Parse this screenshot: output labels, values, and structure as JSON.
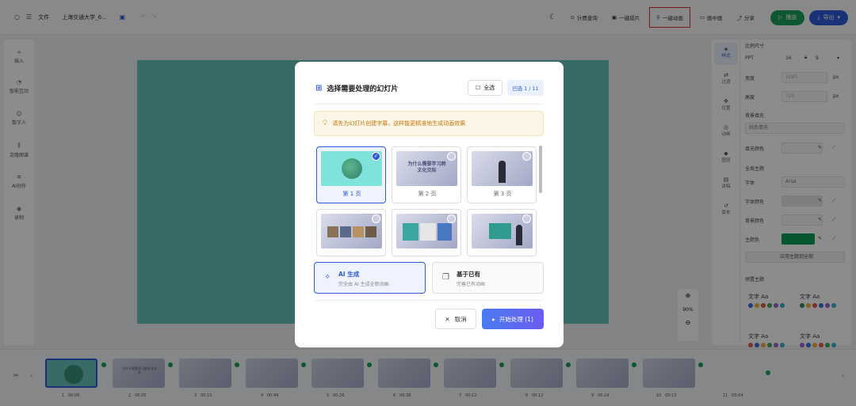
{
  "topbar": {
    "file_menu": "文件",
    "doc_title": "上海交通大学_6...",
    "buttons": [
      {
        "label": "计费查询",
        "icon": "billing-icon"
      },
      {
        "label": "一键成片",
        "icon": "film-icon"
      },
      {
        "label": "一键动画",
        "icon": "animation-icon"
      },
      {
        "label": "画中画",
        "icon": "pip-icon"
      },
      {
        "label": "分享",
        "icon": "share-icon"
      }
    ],
    "play_label": "播放",
    "export_label": "导出"
  },
  "leftbar": {
    "items": [
      {
        "label": "插入",
        "icon": "plus-icon"
      },
      {
        "label": "智能互动",
        "icon": "interact-icon"
      },
      {
        "label": "数字人",
        "icon": "avatar-icon"
      },
      {
        "label": "克隆图谱",
        "icon": "graph-icon"
      },
      {
        "label": "AI创作",
        "icon": "ai-icon"
      },
      {
        "label": "录制",
        "icon": "record-icon"
      }
    ]
  },
  "rightbar": {
    "tabs": [
      {
        "label": "样式",
        "icon": "style-icon",
        "active": true
      },
      {
        "label": "过渡",
        "icon": "transition-icon",
        "active": false
      },
      {
        "label": "位置",
        "icon": "position-icon",
        "active": false
      },
      {
        "label": "动画",
        "icon": "animation-icon",
        "active": false
      },
      {
        "label": "图层",
        "icon": "layers-icon",
        "active": false
      },
      {
        "label": "讲稿",
        "icon": "script-icon",
        "active": false
      },
      {
        "label": "版本",
        "icon": "history-icon",
        "active": false
      }
    ],
    "aspect_title": "比例尺寸",
    "ppt_label": "PPT",
    "ppt_w": "16",
    "ppt_h": "9",
    "width_label": "宽度",
    "width_val": "1280",
    "width_unit": "px",
    "height_label": "高度",
    "height_val": "720",
    "height_unit": "px",
    "bg_title": "背景填充",
    "bg_val": "纯色填充",
    "fill_color_label": "填充颜色",
    "theme_title": "全局主题",
    "font_label": "字体",
    "font_val": "Arial",
    "font_color_label": "字体颜色",
    "bg_color_label": "背景颜色",
    "theme_color_label": "主题色",
    "theme_color": "#0f9d58",
    "apply_label": "应用主题到全部",
    "preset_title": "预置主题",
    "preset_text": "文字 Aa",
    "presets": [
      [
        "#3b6fd4",
        "#e8b53a",
        "#e05a4f",
        "#43a65a",
        "#9a63d1",
        "#3ab0c6"
      ],
      [
        "#2f8f5c",
        "#e8b53a",
        "#e05a4f",
        "#3b6fd4",
        "#9a63d1",
        "#3ab0c6"
      ],
      [
        "#e05a4f",
        "#3b6fd4",
        "#e8b53a",
        "#43a65a",
        "#9a63d1",
        "#3ab0c6"
      ],
      [
        "#9a63d1",
        "#3b6fd4",
        "#e8b53a",
        "#e05a4f",
        "#43a65a",
        "#3ab0c6"
      ]
    ]
  },
  "canvas": {
    "slide_color": "#66c3bd",
    "zoom": "90%"
  },
  "filmstrip": {
    "slides": [
      {
        "n": "1",
        "time": "00:06"
      },
      {
        "n": "2",
        "time": "00:05"
      },
      {
        "n": "3",
        "time": "00:15"
      },
      {
        "n": "4",
        "time": "00:49"
      },
      {
        "n": "5",
        "time": "00:28"
      },
      {
        "n": "6",
        "time": "00:38"
      },
      {
        "n": "7",
        "time": "00:12"
      },
      {
        "n": "8",
        "time": "00:12"
      },
      {
        "n": "9",
        "time": "00:24"
      },
      {
        "n": "10",
        "time": "00:13"
      },
      {
        "n": "11",
        "time": "00:04"
      }
    ],
    "thumb_title": "为什么需要学习跨文化交际"
  },
  "modal": {
    "title": "选择需要处理的幻灯片",
    "select_all": "全选",
    "selected_count": "已选 1 / 11",
    "tip": "请先为幻灯片创建字幕，这样能更精准地生成动画效果",
    "cards": [
      {
        "label": "第 1 页",
        "selected": true
      },
      {
        "label": "第 2 页",
        "selected": false
      },
      {
        "label": "第 3 页",
        "selected": false
      },
      {
        "label": "",
        "selected": false
      },
      {
        "label": "",
        "selected": false
      },
      {
        "label": "",
        "selected": false
      }
    ],
    "slide2_title": "为什么需要学习跨文化交际",
    "modes": [
      {
        "title": "AI 生成",
        "sub": "完全由 AI 生成全新动画",
        "selected": true
      },
      {
        "title": "基于已有",
        "sub": "完善已有动画",
        "selected": false
      }
    ],
    "cancel": "取消",
    "start": "开始处理 (1)"
  }
}
